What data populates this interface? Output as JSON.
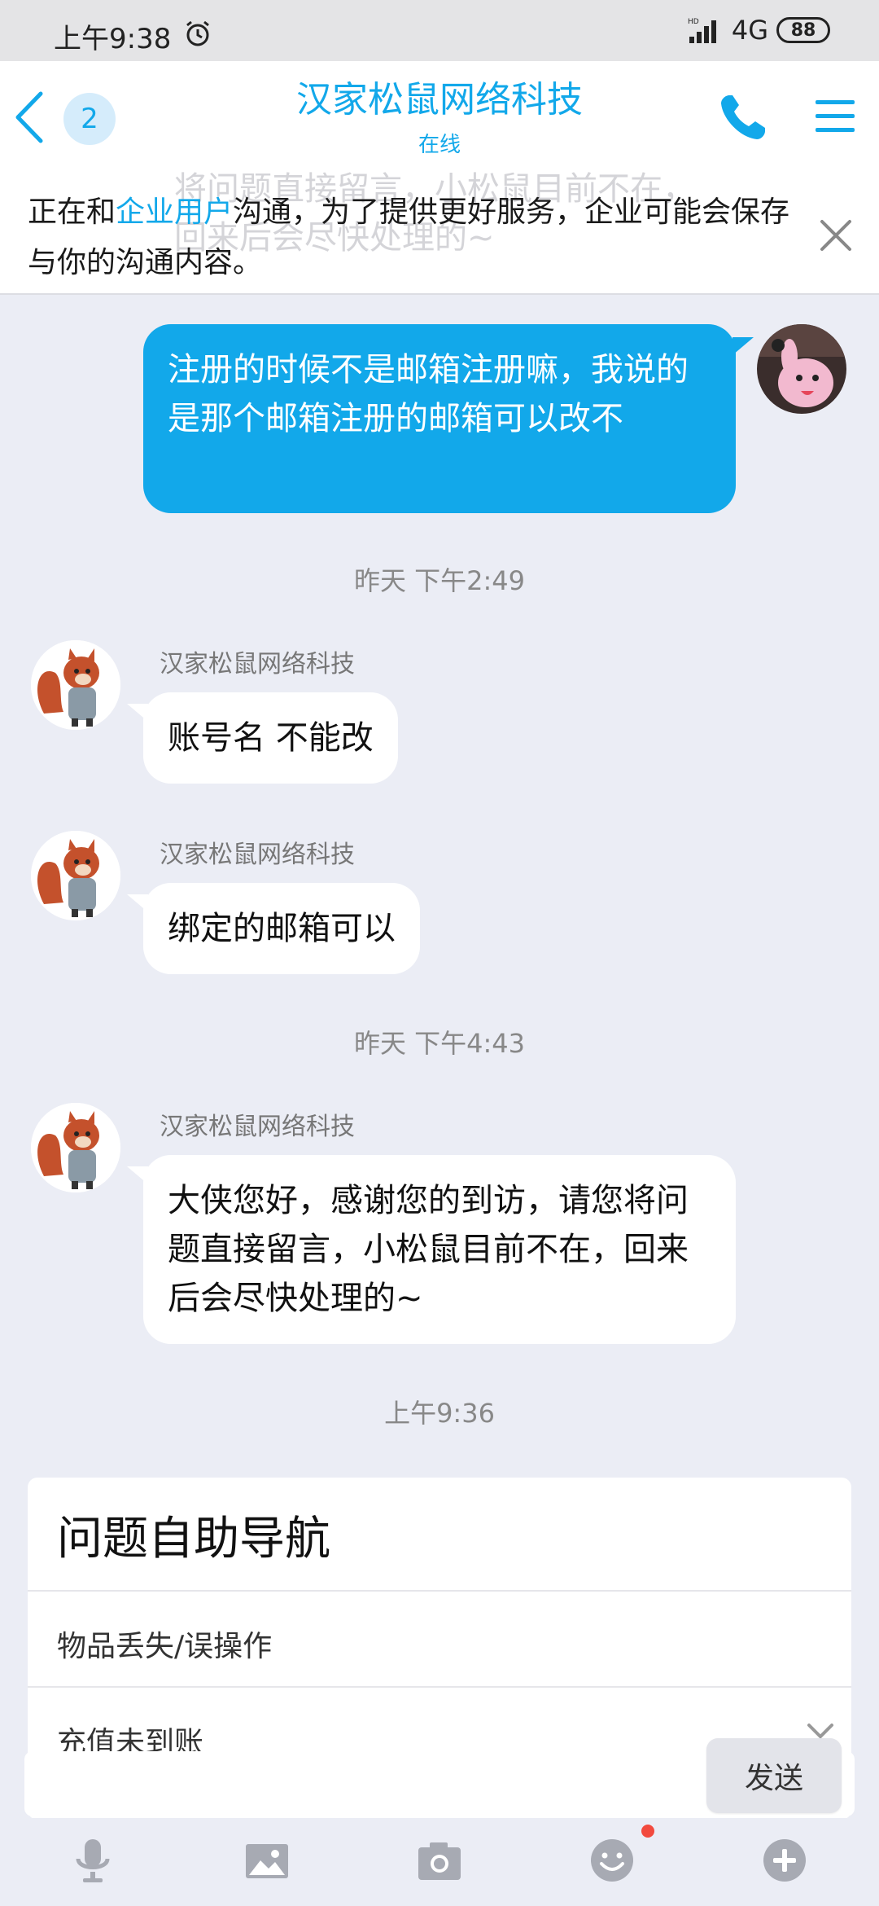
{
  "status_bar": {
    "time": "上午9:38",
    "network": "4G",
    "battery": "88"
  },
  "header": {
    "unread_count": "2",
    "title": "汉家松鼠网络科技",
    "subtitle": "在线"
  },
  "notice": {
    "text_before": "正在和",
    "highlight": "企业用户",
    "text_after": "沟通，为了提供更好服务，企业可能会保存与你的沟通内容。",
    "ghost_text": "将问题直接留言，小松鼠目前不在，回来后会尽快处理的~"
  },
  "messages": {
    "outgoing_1": "注册的时候不是邮箱注册嘛，我说的是那个邮箱注册的邮箱可以改不",
    "ts_1": "昨天 下午2:49",
    "sender": "汉家松鼠网络科技",
    "incoming_1": "账号名 不能改",
    "incoming_2": "绑定的邮箱可以",
    "ts_2": "昨天 下午4:43",
    "incoming_3": "大侠您好，感谢您的到访，请您将问题直接留言，小松鼠目前不在，回来后会尽快处理的~",
    "ts_3": "上午9:36"
  },
  "help_card": {
    "title": "问题自助导航",
    "items": [
      "物品丢失/误操作",
      "充值未到账"
    ]
  },
  "input": {
    "send_label": "发送"
  },
  "colors": {
    "accent": "#12a8ea",
    "background": "#ebedf5",
    "badge_red": "#f24a3e"
  },
  "toolbar": {
    "icons": [
      "mic-icon",
      "image-icon",
      "camera-icon",
      "emoji-icon",
      "plus-icon"
    ]
  }
}
